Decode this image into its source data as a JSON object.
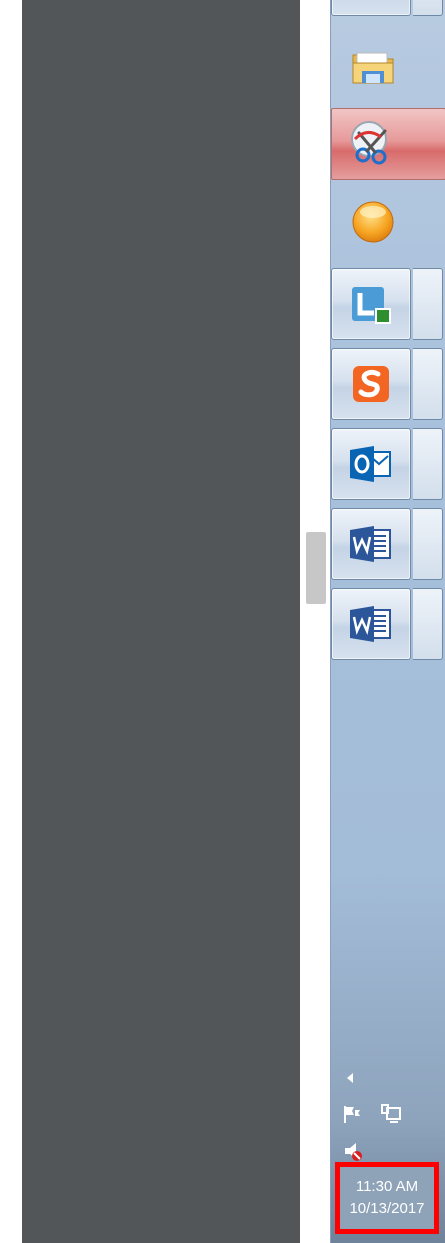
{
  "taskbar": {
    "buttons": [
      {
        "name": "chrome-taskbar-button",
        "icon": "chrome-icon",
        "state": "running"
      },
      {
        "name": "file-explorer-taskbar-button",
        "icon": "folder-icon",
        "state": "pinned"
      },
      {
        "name": "snipping-tool-taskbar-button",
        "icon": "scissors-icon",
        "state": "active"
      },
      {
        "name": "orb-app-taskbar-button",
        "icon": "orange-orb-icon",
        "state": "pinned"
      },
      {
        "name": "lync-taskbar-button",
        "icon": "lync-icon",
        "state": "running"
      },
      {
        "name": "snagit-taskbar-button",
        "icon": "snagit-icon",
        "state": "running"
      },
      {
        "name": "outlook-taskbar-button",
        "icon": "outlook-icon",
        "state": "running"
      },
      {
        "name": "word-taskbar-button-1",
        "icon": "word-icon",
        "state": "running"
      },
      {
        "name": "word-taskbar-button-2",
        "icon": "word-icon",
        "state": "running"
      }
    ],
    "colors": {
      "background": "#a6bfdb",
      "highlight": "#ff0000",
      "active": "#d86b6b"
    }
  },
  "tray": {
    "show_hidden_icon": "chevron-left-icon",
    "action_center_icon": "flag-icon",
    "network_icon": "network-icon",
    "volume_icon": "speaker-muted-icon"
  },
  "clock": {
    "time": "11:30 AM",
    "date": "10/13/2017"
  }
}
